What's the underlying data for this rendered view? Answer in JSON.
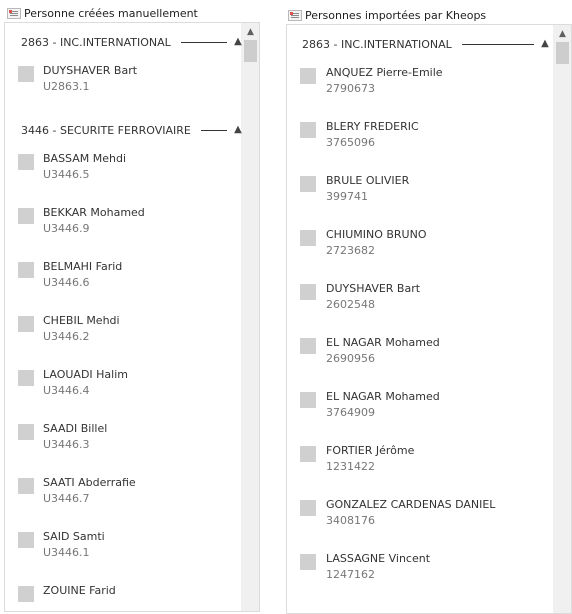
{
  "left": {
    "title": "Personne créées manuellement",
    "groups": [
      {
        "label": "2863 - INC.INTERNATIONAL",
        "toggle": "▲",
        "items": [
          {
            "name": "DUYSHAVER Bart",
            "code": "U2863.1"
          }
        ]
      },
      {
        "label": "3446 - SECURITE FERROVIAIRE",
        "toggle": "▲",
        "items": [
          {
            "name": "BASSAM Mehdi",
            "code": "U3446.5"
          },
          {
            "name": "BEKKAR Mohamed",
            "code": "U3446.9"
          },
          {
            "name": "BELMAHI Farid",
            "code": "U3446.6"
          },
          {
            "name": "CHEBIL Mehdi",
            "code": "U3446.2"
          },
          {
            "name": "LAOUADI Halim",
            "code": "U3446.4"
          },
          {
            "name": "SAADI Billel",
            "code": "U3446.3"
          },
          {
            "name": "SAATI Abderrafie",
            "code": "U3446.7"
          },
          {
            "name": "SAID Samti",
            "code": "U3446.1"
          },
          {
            "name": "ZOUINE Farid",
            "code": ""
          }
        ]
      }
    ]
  },
  "right": {
    "title": "Personnes importées par Kheops",
    "groups": [
      {
        "label": "2863 - INC.INTERNATIONAL",
        "toggle": "▲",
        "items": [
          {
            "name": "ANQUEZ Pierre-Emile",
            "code": "2790673"
          },
          {
            "name": "BLERY FREDERIC",
            "code": "3765096"
          },
          {
            "name": "BRULE OLIVIER",
            "code": "399741"
          },
          {
            "name": "CHIUMINO BRUNO",
            "code": "2723682"
          },
          {
            "name": "DUYSHAVER Bart",
            "code": "2602548"
          },
          {
            "name": "EL NAGAR Mohamed",
            "code": "2690956"
          },
          {
            "name": "EL NAGAR Mohamed",
            "code": "3764909"
          },
          {
            "name": "FORTIER Jérôme",
            "code": "1231422"
          },
          {
            "name": "GONZALEZ CARDENAS DANIEL",
            "code": "3408176"
          },
          {
            "name": "LASSAGNE Vincent",
            "code": "1247162"
          }
        ]
      }
    ]
  },
  "scrollbar": {
    "up_arrow": "▲"
  }
}
